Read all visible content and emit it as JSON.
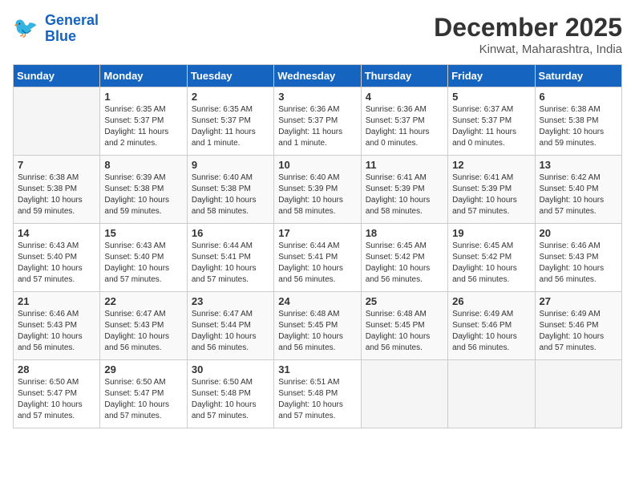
{
  "header": {
    "logo_line1": "General",
    "logo_line2": "Blue",
    "month": "December 2025",
    "location": "Kinwat, Maharashtra, India"
  },
  "days_of_week": [
    "Sunday",
    "Monday",
    "Tuesday",
    "Wednesday",
    "Thursday",
    "Friday",
    "Saturday"
  ],
  "weeks": [
    [
      {
        "day": "",
        "info": ""
      },
      {
        "day": "1",
        "info": "Sunrise: 6:35 AM\nSunset: 5:37 PM\nDaylight: 11 hours\nand 2 minutes."
      },
      {
        "day": "2",
        "info": "Sunrise: 6:35 AM\nSunset: 5:37 PM\nDaylight: 11 hours\nand 1 minute."
      },
      {
        "day": "3",
        "info": "Sunrise: 6:36 AM\nSunset: 5:37 PM\nDaylight: 11 hours\nand 1 minute."
      },
      {
        "day": "4",
        "info": "Sunrise: 6:36 AM\nSunset: 5:37 PM\nDaylight: 11 hours\nand 0 minutes."
      },
      {
        "day": "5",
        "info": "Sunrise: 6:37 AM\nSunset: 5:37 PM\nDaylight: 11 hours\nand 0 minutes."
      },
      {
        "day": "6",
        "info": "Sunrise: 6:38 AM\nSunset: 5:38 PM\nDaylight: 10 hours\nand 59 minutes."
      }
    ],
    [
      {
        "day": "7",
        "info": "Sunrise: 6:38 AM\nSunset: 5:38 PM\nDaylight: 10 hours\nand 59 minutes."
      },
      {
        "day": "8",
        "info": "Sunrise: 6:39 AM\nSunset: 5:38 PM\nDaylight: 10 hours\nand 59 minutes."
      },
      {
        "day": "9",
        "info": "Sunrise: 6:40 AM\nSunset: 5:38 PM\nDaylight: 10 hours\nand 58 minutes."
      },
      {
        "day": "10",
        "info": "Sunrise: 6:40 AM\nSunset: 5:39 PM\nDaylight: 10 hours\nand 58 minutes."
      },
      {
        "day": "11",
        "info": "Sunrise: 6:41 AM\nSunset: 5:39 PM\nDaylight: 10 hours\nand 58 minutes."
      },
      {
        "day": "12",
        "info": "Sunrise: 6:41 AM\nSunset: 5:39 PM\nDaylight: 10 hours\nand 57 minutes."
      },
      {
        "day": "13",
        "info": "Sunrise: 6:42 AM\nSunset: 5:40 PM\nDaylight: 10 hours\nand 57 minutes."
      }
    ],
    [
      {
        "day": "14",
        "info": "Sunrise: 6:43 AM\nSunset: 5:40 PM\nDaylight: 10 hours\nand 57 minutes."
      },
      {
        "day": "15",
        "info": "Sunrise: 6:43 AM\nSunset: 5:40 PM\nDaylight: 10 hours\nand 57 minutes."
      },
      {
        "day": "16",
        "info": "Sunrise: 6:44 AM\nSunset: 5:41 PM\nDaylight: 10 hours\nand 57 minutes."
      },
      {
        "day": "17",
        "info": "Sunrise: 6:44 AM\nSunset: 5:41 PM\nDaylight: 10 hours\nand 56 minutes."
      },
      {
        "day": "18",
        "info": "Sunrise: 6:45 AM\nSunset: 5:42 PM\nDaylight: 10 hours\nand 56 minutes."
      },
      {
        "day": "19",
        "info": "Sunrise: 6:45 AM\nSunset: 5:42 PM\nDaylight: 10 hours\nand 56 minutes."
      },
      {
        "day": "20",
        "info": "Sunrise: 6:46 AM\nSunset: 5:43 PM\nDaylight: 10 hours\nand 56 minutes."
      }
    ],
    [
      {
        "day": "21",
        "info": "Sunrise: 6:46 AM\nSunset: 5:43 PM\nDaylight: 10 hours\nand 56 minutes."
      },
      {
        "day": "22",
        "info": "Sunrise: 6:47 AM\nSunset: 5:43 PM\nDaylight: 10 hours\nand 56 minutes."
      },
      {
        "day": "23",
        "info": "Sunrise: 6:47 AM\nSunset: 5:44 PM\nDaylight: 10 hours\nand 56 minutes."
      },
      {
        "day": "24",
        "info": "Sunrise: 6:48 AM\nSunset: 5:45 PM\nDaylight: 10 hours\nand 56 minutes."
      },
      {
        "day": "25",
        "info": "Sunrise: 6:48 AM\nSunset: 5:45 PM\nDaylight: 10 hours\nand 56 minutes."
      },
      {
        "day": "26",
        "info": "Sunrise: 6:49 AM\nSunset: 5:46 PM\nDaylight: 10 hours\nand 56 minutes."
      },
      {
        "day": "27",
        "info": "Sunrise: 6:49 AM\nSunset: 5:46 PM\nDaylight: 10 hours\nand 57 minutes."
      }
    ],
    [
      {
        "day": "28",
        "info": "Sunrise: 6:50 AM\nSunset: 5:47 PM\nDaylight: 10 hours\nand 57 minutes."
      },
      {
        "day": "29",
        "info": "Sunrise: 6:50 AM\nSunset: 5:47 PM\nDaylight: 10 hours\nand 57 minutes."
      },
      {
        "day": "30",
        "info": "Sunrise: 6:50 AM\nSunset: 5:48 PM\nDaylight: 10 hours\nand 57 minutes."
      },
      {
        "day": "31",
        "info": "Sunrise: 6:51 AM\nSunset: 5:48 PM\nDaylight: 10 hours\nand 57 minutes."
      },
      {
        "day": "",
        "info": ""
      },
      {
        "day": "",
        "info": ""
      },
      {
        "day": "",
        "info": ""
      }
    ]
  ]
}
